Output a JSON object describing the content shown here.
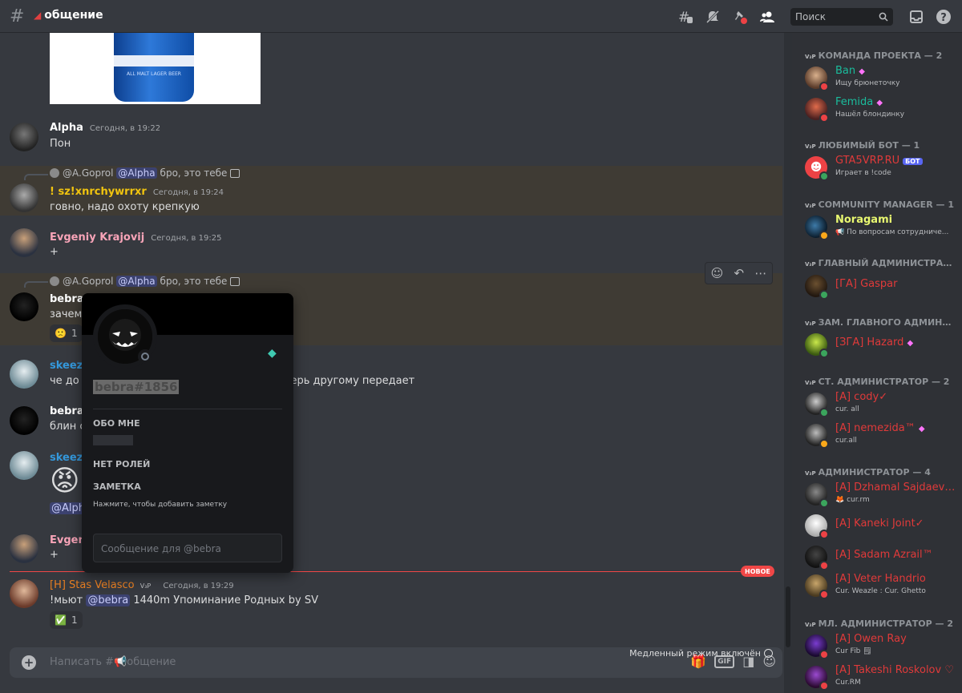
{
  "header": {
    "channel_name": "общение",
    "search_placeholder": "Поиск"
  },
  "image_can_text": "ALL MALT LAGER BEER",
  "messages": [
    {
      "author": "Alpha",
      "time": "Сегодня, в 19:22",
      "text": "Пон"
    },
    {
      "reply_author": "@A.Goprol",
      "reply_mention": "@Alpha",
      "reply_text": "бро, это тебе",
      "author": "! sz!xnrchywrrxr",
      "time": "Сегодня, в 19:24",
      "text": "говно, надо охоту крепкую"
    },
    {
      "author": "Evgeniy Krajovij",
      "time": "Сегодня, в 19:25",
      "text": "+"
    },
    {
      "reply_author": "@A.Goprol",
      "reply_mention": "@Alpha",
      "reply_text": "бро, это тебе",
      "author": "bebra",
      "text": "зачем",
      "reaction_emoji": "🙁",
      "reaction_count": "1"
    },
    {
      "author": "skeezy",
      "text_start": "че до п",
      "text_end": "перь другому передает"
    },
    {
      "author": "bebra",
      "text": "блин с"
    },
    {
      "author": "skeezy",
      "emoji": "😡",
      "mention": "@Alph"
    },
    {
      "author": "Evgeniy",
      "text": "+"
    },
    {
      "author": "[H] Stas Velasco",
      "tag": "V₃P",
      "time": "Сегодня, в 19:29",
      "text_start": "!мьют",
      "mention": "@bebra",
      "text_end": "1440m Упоминание Родных by SV",
      "reaction_emoji": "✅",
      "reaction_count": "1"
    }
  ],
  "new_badge": "НОВОЕ",
  "input": {
    "placeholder": "Написать #📢общение",
    "gif": "GIF",
    "slow_mode": "Медленный режим включён"
  },
  "profile": {
    "username": "bebra#1856",
    "about_label": "ОБО МНЕ",
    "roles_label": "НЕТ РОЛЕЙ",
    "note_label": "ЗАМЕТКА",
    "note_placeholder": "Нажмите, чтобы добавить заметку",
    "message_placeholder": "Сообщение для @bebra"
  },
  "members": {
    "groups": [
      {
        "title": "КОМАНДА ПРОЕКТА — 2"
      },
      {
        "title": "ЛЮБИМЫЙ БОТ — 1"
      },
      {
        "title": "COMMUNITY MANAGER — 1"
      },
      {
        "title": "ГЛАВНЫЙ АДМИНИСТРАТОР ..."
      },
      {
        "title": "ЗАМ. ГЛАВНОГО АДМИНИСТ..."
      },
      {
        "title": "СТ. АДМИНИСТРАТОР — 2"
      },
      {
        "title": "АДМИНИСТРАТОР — 4"
      },
      {
        "title": "МЛ. АДМИНИСТРАТОР — 2"
      }
    ],
    "list": [
      {
        "name": "Ban",
        "status": "Ищу брюнеточку"
      },
      {
        "name": "Femida",
        "status": "Нашёл блондинку"
      },
      {
        "name": "GTA5VRP.RU",
        "badge": "БОТ",
        "status": "Играет в !code"
      },
      {
        "name": "Noragami",
        "status": "📢 По вопросам сотрудниче..."
      },
      {
        "name": "[ГА] Gaspar"
      },
      {
        "name": "[ЗГА] Hazard"
      },
      {
        "name": "[A] cody✓",
        "status": "cur. all"
      },
      {
        "name": "[A] nemezida™",
        "status": "cur.all"
      },
      {
        "name": "[A] Dzhamal Sajdaev ♡",
        "status": "🦊 cur.rm"
      },
      {
        "name": "[A] Kaneki Joint✓"
      },
      {
        "name": "[A] Sadam Azrail™"
      },
      {
        "name": "[A] Veter Handrio",
        "status": "Cur. Weazle : Cur. Ghetto"
      },
      {
        "name": "[A] Owen Ray",
        "status": "Cur Fib 🗒"
      },
      {
        "name": "[A] Takeshi Roskolov ♡",
        "status": "Cur.RM"
      }
    ],
    "vrp_tag": "V₃P"
  },
  "colors": {
    "bg": "#36393f",
    "sidebar": "#2f3136",
    "online": "#3ba55d",
    "dnd": "#ed4245",
    "idle": "#faa81a",
    "admin_red": "#e03a3a",
    "team_green": "#1abc9c",
    "mention_bg": "#3c4270",
    "highlight": "#3f3b34"
  }
}
